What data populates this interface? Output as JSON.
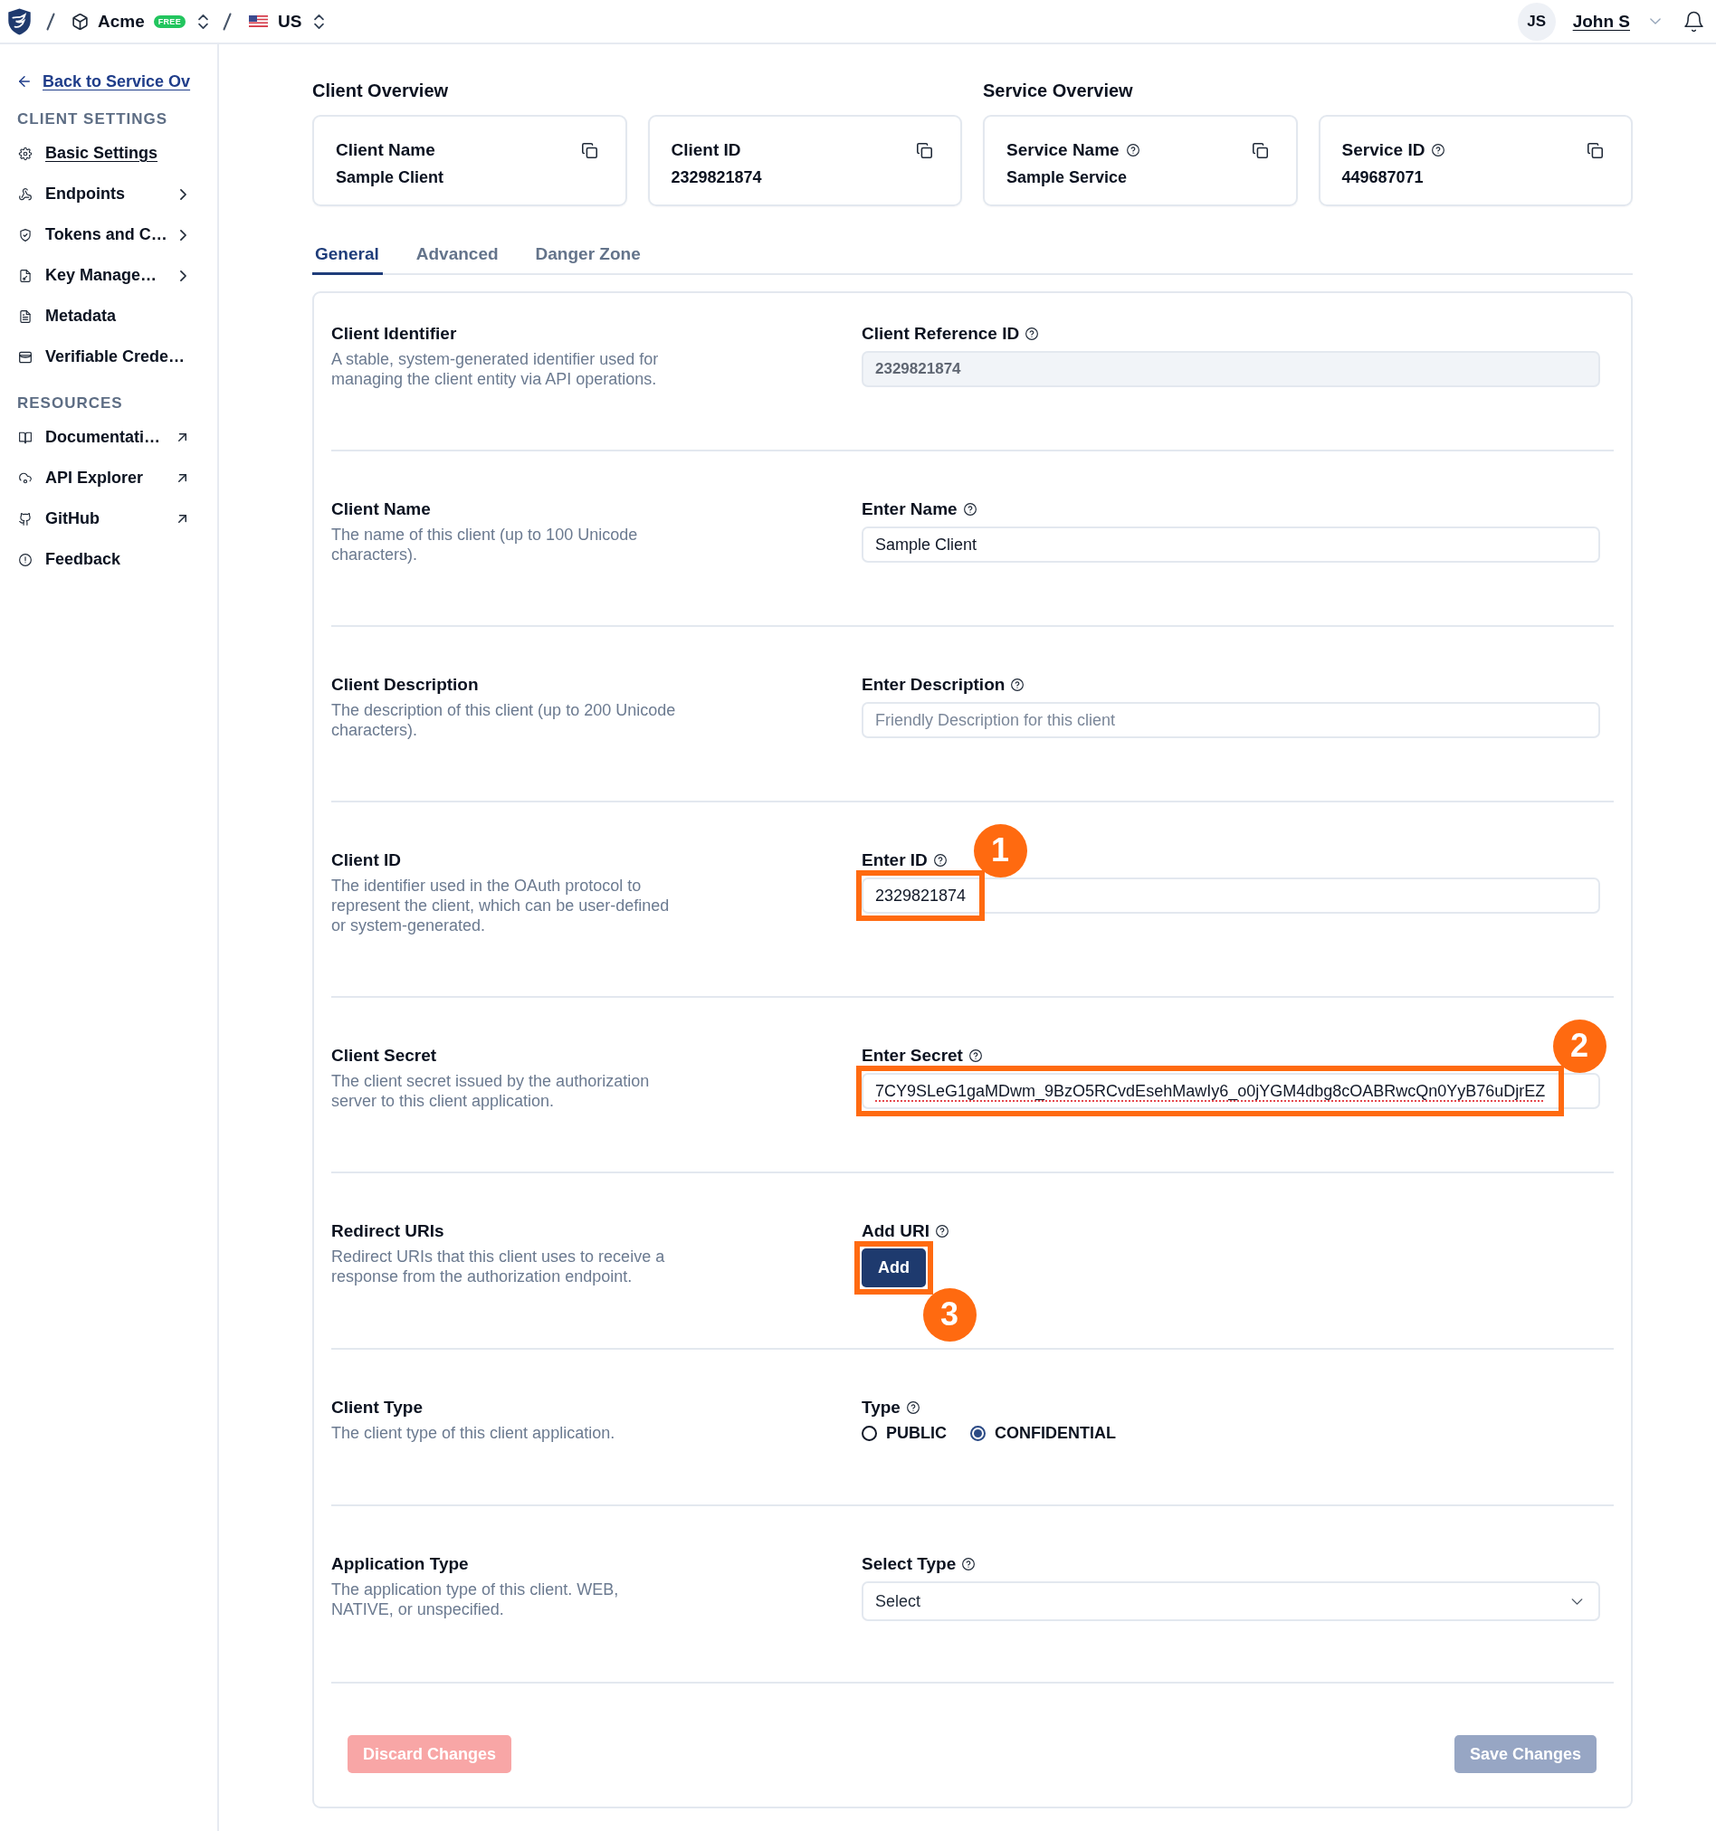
{
  "topbar": {
    "breadcrumb": [
      {
        "kind": "org",
        "label": "Acme",
        "badge": "FREE"
      },
      {
        "kind": "region",
        "label": "US"
      }
    ],
    "user": {
      "initials": "JS",
      "name": "John S"
    }
  },
  "sidebar": {
    "back_link": "Back to Service Ov",
    "groups": [
      {
        "heading": "CLIENT SETTINGS",
        "items": [
          {
            "label": "Basic Settings",
            "kind": "page",
            "selected": true
          },
          {
            "label": "Endpoints",
            "kind": "group",
            "selected": false
          },
          {
            "label": "Tokens and C…",
            "kind": "group",
            "selected": false
          },
          {
            "label": "Key Manage…",
            "kind": "group",
            "selected": false
          },
          {
            "label": "Metadata",
            "kind": "page",
            "selected": false
          },
          {
            "label": "Verifiable Crede…",
            "kind": "page",
            "selected": false
          }
        ]
      },
      {
        "heading": "RESOURCES",
        "items": [
          {
            "label": "Documentati…",
            "kind": "external",
            "selected": false
          },
          {
            "label": "API Explorer",
            "kind": "external",
            "selected": false
          },
          {
            "label": "GitHub",
            "kind": "external",
            "selected": false
          },
          {
            "label": "Feedback",
            "kind": "page",
            "selected": false
          }
        ]
      }
    ]
  },
  "overview": [
    {
      "title": "Client Overview",
      "cards": [
        {
          "label": "Client Name",
          "help": false,
          "value": "Sample Client"
        },
        {
          "label": "Client ID",
          "help": false,
          "value": "2329821874"
        }
      ]
    },
    {
      "title": "Service Overview",
      "cards": [
        {
          "label": "Service Name",
          "help": true,
          "value": "Sample Service"
        },
        {
          "label": "Service ID",
          "help": true,
          "value": "449687071"
        }
      ]
    }
  ],
  "tabs": [
    {
      "label": "General",
      "selected": true
    },
    {
      "label": "Advanced",
      "selected": false
    },
    {
      "label": "Danger Zone",
      "selected": false
    }
  ],
  "sections": [
    {
      "title": "Client Identifier",
      "description": "A stable, system-generated identifier used for managing the client entity via API operations.",
      "field": {
        "kind": "readonly",
        "label": "Client Reference ID",
        "help": true,
        "value": "2329821874"
      }
    },
    {
      "title": "Client Name",
      "description": "The name of this client (up to 100 Unicode characters).",
      "field": {
        "kind": "text",
        "label": "Enter Name",
        "help": true,
        "value": "Sample Client"
      }
    },
    {
      "title": "Client Description",
      "description": "The description of this client (up to 200 Unicode characters).",
      "field": {
        "kind": "text",
        "label": "Enter Description",
        "help": true,
        "placeholder": "Friendly Description for this client"
      }
    },
    {
      "title": "Client ID",
      "description": "The identifier used in the OAuth protocol to represent the client, which can be user-defined or system-generated.",
      "field": {
        "kind": "text",
        "label": "Enter ID",
        "help": true,
        "value": "2329821874",
        "callout": "1"
      }
    },
    {
      "title": "Client Secret",
      "description": "The client secret issued by the authorization server to this client application.",
      "field": {
        "kind": "text",
        "label": "Enter Secret",
        "help": true,
        "value": "7CY9SLeG1gaMDwm_9BzO5RCvdEsehMawIy6_o0jYGM4dbg8cOABRwcQn0YyB76uDjrEZ",
        "spell_error": true,
        "callout": "2"
      }
    },
    {
      "title": "Redirect URIs",
      "description": "Redirect URIs that this client uses to receive a response from the authorization endpoint.",
      "field": {
        "kind": "button",
        "label": "Add URI",
        "help": true,
        "button": "Add",
        "callout": "3"
      }
    },
    {
      "title": "Client Type",
      "description": "The client type of this client application.",
      "field": {
        "kind": "radio",
        "label": "Type",
        "help": true,
        "options": [
          {
            "label": "PUBLIC",
            "selected": false
          },
          {
            "label": "CONFIDENTIAL",
            "selected": true
          }
        ]
      }
    },
    {
      "title": "Application Type",
      "description": "The application type of this client. WEB, NATIVE, or unspecified.",
      "field": {
        "kind": "select",
        "label": "Select Type",
        "help": true,
        "placeholder": "Select"
      }
    }
  ],
  "footer_buttons": [
    {
      "kind": "discard",
      "label": "Discard Changes",
      "disabled": true
    },
    {
      "kind": "save",
      "label": "Save Changes",
      "disabled": true
    }
  ]
}
